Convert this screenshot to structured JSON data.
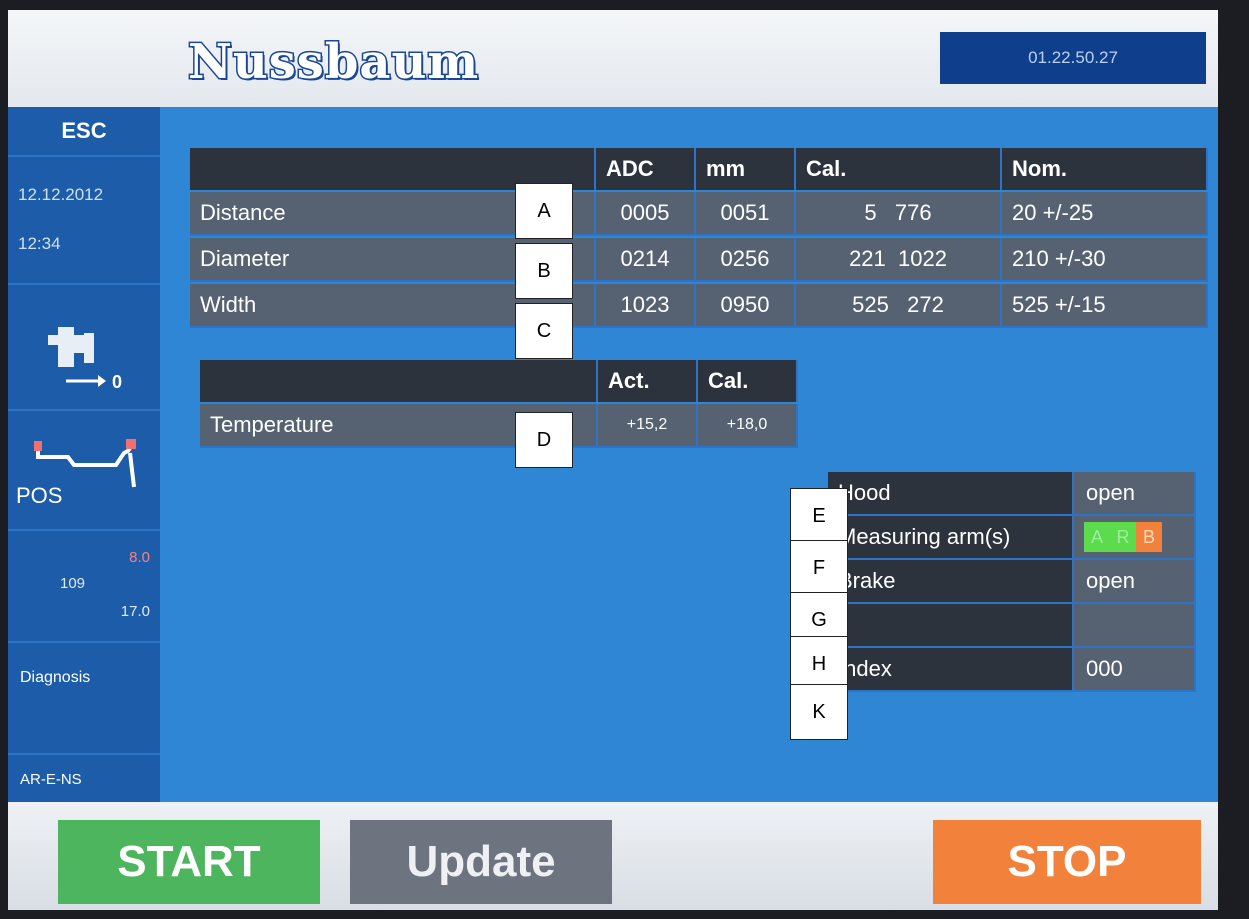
{
  "brand": "Nussbaum",
  "version": "01.22.50.27",
  "sidebar": {
    "esc": "ESC",
    "date": "12.12.2012",
    "time": "12:34",
    "pos_label": "POS",
    "dim_a": "8.0",
    "dim_b": "109",
    "dim_c": "17.0",
    "diagnosis": "Diagnosis",
    "model": "AR-E-NS"
  },
  "measure_table": {
    "headers": [
      "",
      "ADC",
      "mm",
      "Cal.",
      "Nom."
    ],
    "rows": [
      {
        "label": "Distance",
        "adc": "0005",
        "mm": "0051",
        "cal": "5   776",
        "nom": "20 +/-25"
      },
      {
        "label": "Diameter",
        "adc": "0214",
        "mm": "0256",
        "cal": "221  1022",
        "nom": "210 +/-30"
      },
      {
        "label": "Width",
        "adc": "1023",
        "mm": "0950",
        "cal": "525   272",
        "nom": "525 +/-15"
      }
    ]
  },
  "temp_table": {
    "headers": [
      "",
      "Act.",
      "Cal."
    ],
    "row": {
      "label": "Temperature",
      "act": "+15,2",
      "cal": "+18,0"
    }
  },
  "status_table": {
    "rows": [
      {
        "label": "Hood",
        "value": "open"
      },
      {
        "label": "Measuring arm(s)",
        "arms": [
          "A",
          "R",
          "B"
        ]
      },
      {
        "label": "Brake",
        "value": "open"
      },
      {
        "label": "",
        "value": ""
      },
      {
        "label": "Index",
        "value": "000"
      }
    ]
  },
  "overlay_labels": [
    "A",
    "B",
    "C",
    "D",
    "E",
    "F",
    "G",
    "H",
    "K"
  ],
  "buttons": {
    "start": "START",
    "update": "Update",
    "stop": "STOP"
  },
  "colors": {
    "start": "#4db55d",
    "update": "#6d7480",
    "stop": "#f2823b",
    "arm_ok": "#5cdc4c",
    "arm_warn": "#f2823b"
  }
}
